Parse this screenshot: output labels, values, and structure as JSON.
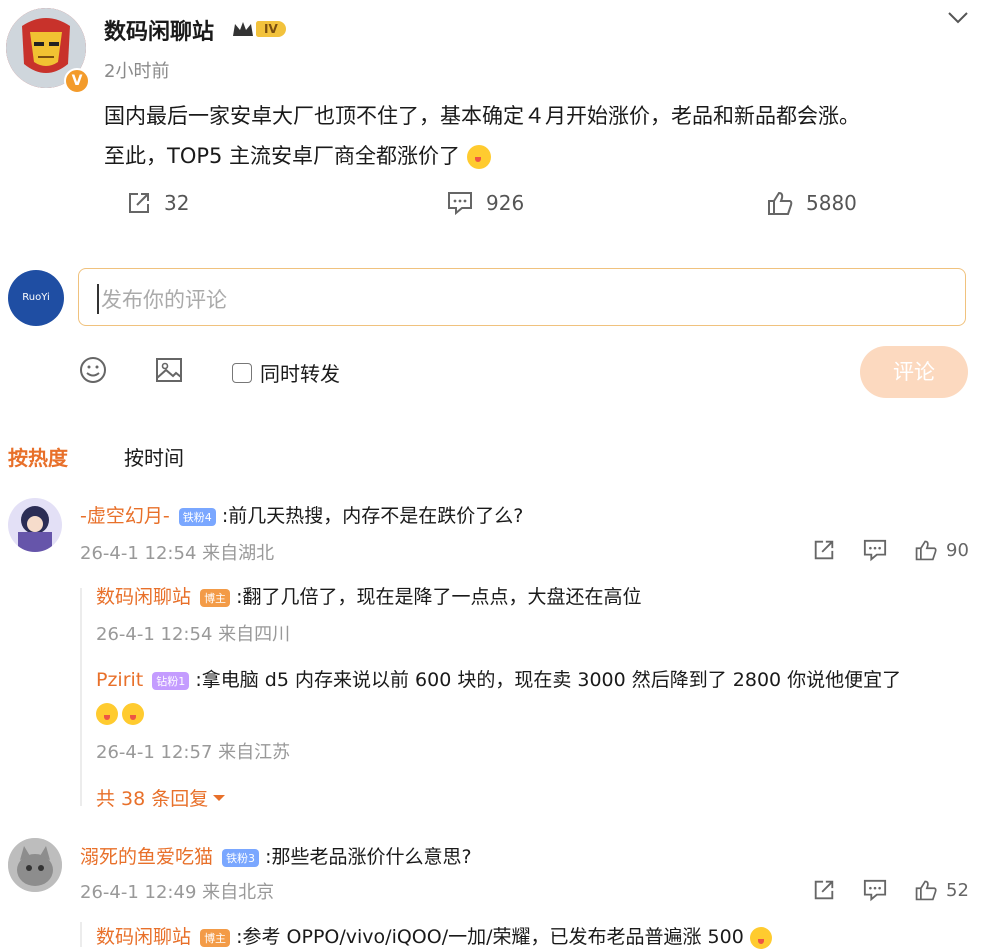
{
  "post": {
    "author": "数码闲聊站",
    "level_badge": "IV",
    "time": "2小时前",
    "content_line1": "国内最后一家安卓大厂也顶不住了，基本确定４月开始涨价，老品和新品都会涨。",
    "content_line2": "至此，TOP5 主流安卓厂商全都涨价了",
    "reposts": "32",
    "comments": "926",
    "likes": "5880"
  },
  "composer": {
    "avatar_text": "RuoYi",
    "placeholder": "发布你的评论",
    "sync_label": "同时转发",
    "submit_label": "评论"
  },
  "sort_tabs": {
    "hot": "按热度",
    "time": "按时间"
  },
  "comments": [
    {
      "name": "-虚空幻月-",
      "badge": "铁粉4",
      "text": ":前几天热搜，内存不是在跌价了么?",
      "meta": "26-4-1 12:54 来自湖北",
      "likes": "90",
      "replies": [
        {
          "name": "数码闲聊站",
          "badge": "博主",
          "text": ":翻了几倍了，现在是降了一点点，大盘还在高位",
          "meta": "26-4-1 12:54 来自四川"
        },
        {
          "name": "Pzirit",
          "badge": "钻粉1",
          "text": ":拿电脑 d5 内存来说以前 600 块的，现在卖 3000 然后降到了 2800 你说他便宜了",
          "meta": "26-4-1 12:57 来自江苏"
        }
      ],
      "more_replies": "共 38 条回复"
    },
    {
      "name": "溺死的鱼爱吃猫",
      "badge": "铁粉3",
      "text": ":那些老品涨价什么意思?",
      "meta": "26-4-1 12:49 来自北京",
      "likes": "52",
      "replies": [
        {
          "name": "数码闲聊站",
          "badge": "博主",
          "text": ":参考 OPPO/vivo/iQOO/一加/荣耀，已发布老品普遍涨 500"
        }
      ]
    }
  ],
  "colors": {
    "accent": "#e8702a",
    "submit_bg": "#fcd9bf",
    "input_border": "#f0c27e"
  },
  "icons": [
    "chevron-down-icon",
    "repost-icon",
    "comment-icon",
    "like-icon",
    "emoji-icon",
    "image-icon",
    "checkbox-icon",
    "verified-icon"
  ]
}
